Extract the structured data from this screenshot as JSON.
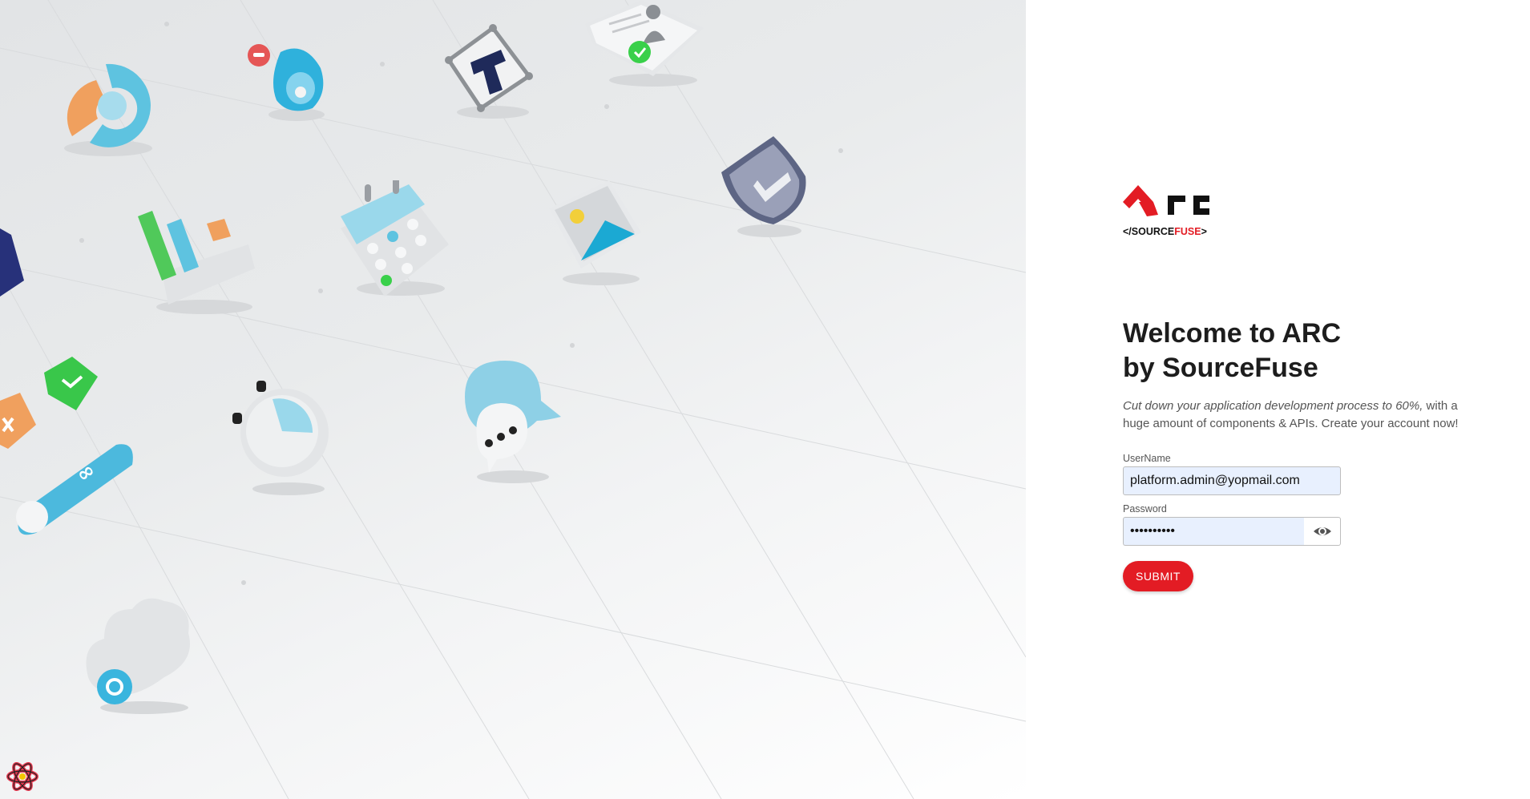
{
  "brand": {
    "logo_text_prefix": "</SOURCE",
    "logo_text_fuse": "FUSE",
    "logo_text_suffix": ">",
    "colors": {
      "brand_red": "#e31c24",
      "input_fill": "#e8f0fe"
    }
  },
  "welcome": {
    "title_line1": "Welcome to ARC",
    "title_line2": "by SourceFuse",
    "subtitle_italic": "Cut down your application development process to 60%,",
    "subtitle_rest": " with a huge amount of components & APIs. Create your account now!"
  },
  "form": {
    "username_label": "UserName",
    "username_value": "platform.admin@yopmail.com",
    "password_label": "Password",
    "password_value": "••••••••••",
    "submit_label": "SUBMIT"
  },
  "icons": {
    "password_toggle": "eye-icon",
    "devtools": "react-icon"
  }
}
